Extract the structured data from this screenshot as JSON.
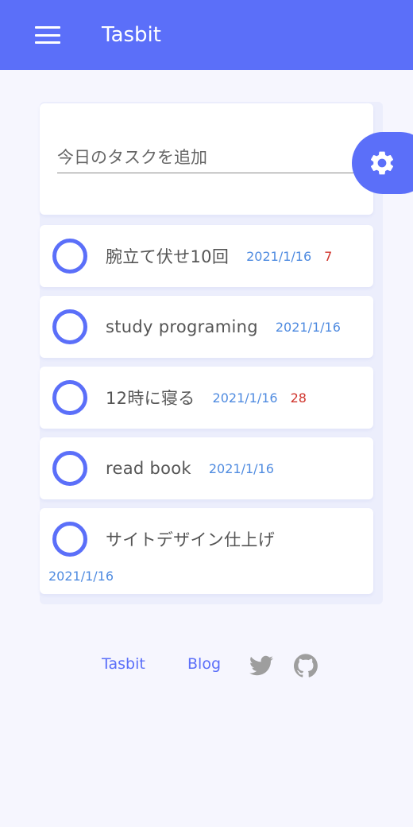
{
  "header": {
    "title": "Tasbit",
    "menu_icon": "hamburger-menu-icon"
  },
  "add_task": {
    "placeholder": "今日のタスクを追加",
    "value": ""
  },
  "settings_fab": {
    "icon": "gear-icon"
  },
  "tasks": [
    {
      "title": "腕立て伏せ10回",
      "date": "2021/1/16",
      "count": "7"
    },
    {
      "title": "study programing",
      "date": "2021/1/16",
      "count": ""
    },
    {
      "title": "12時に寝る",
      "date": "2021/1/16",
      "count": "28"
    },
    {
      "title": "read book",
      "date": "2021/1/16",
      "count": ""
    },
    {
      "title": "サイトデザイン仕上げ",
      "date": "2021/1/16",
      "count": ""
    }
  ],
  "footer": {
    "links": [
      "Tasbit",
      "Blog"
    ],
    "icons": [
      "twitter-icon",
      "github-icon"
    ]
  },
  "colors": {
    "primary": "#5b6ff9",
    "background": "#f6f6fe",
    "date": "#4f8be0",
    "count": "#d0342c",
    "footer_icon": "#9e9e9e"
  }
}
